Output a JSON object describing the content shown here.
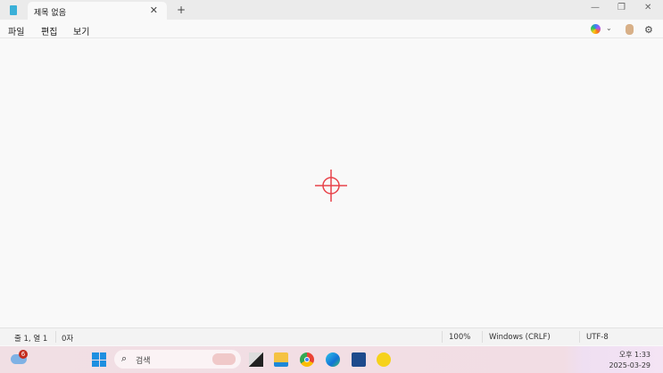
{
  "tab": {
    "title": "제목 없음",
    "close": "✕",
    "new_tab": "+"
  },
  "window": {
    "minimize": "—",
    "restore": "❐",
    "close": "✕"
  },
  "menu": [
    "파일",
    "편집",
    "보기"
  ],
  "status": {
    "position": "줄 1, 열 1",
    "chars": "0자",
    "zoom": "100%",
    "line_ending": "Windows (CRLF)",
    "encoding": "UTF-8"
  },
  "taskbar": {
    "search_placeholder": "검색",
    "weather_badge": "6",
    "time": "오후 1:33",
    "date": "2025-03-29"
  }
}
